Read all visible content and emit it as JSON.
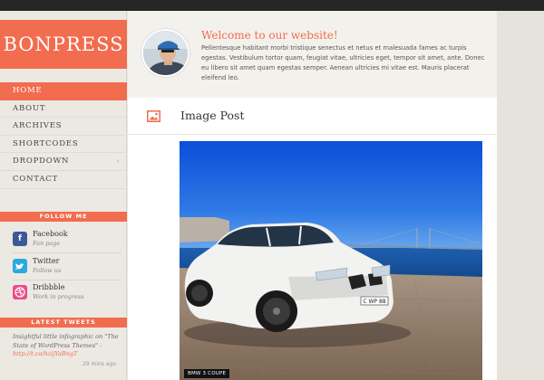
{
  "site": {
    "logo": "BONPRESS"
  },
  "nav": {
    "items": [
      {
        "label": "HOME",
        "active": true
      },
      {
        "label": "ABOUT"
      },
      {
        "label": "ARCHIVES"
      },
      {
        "label": "SHORTCODES"
      },
      {
        "label": "DROPDOWN",
        "has_submenu": true
      },
      {
        "label": "CONTACT"
      }
    ],
    "submenu_arrow": "›"
  },
  "follow": {
    "title": "FOLLOW ME",
    "items": [
      {
        "name": "Facebook",
        "sub": "Fan page",
        "icon": "facebook-icon",
        "color": "#3b5998"
      },
      {
        "name": "Twitter",
        "sub": "Follow us",
        "icon": "twitter-icon",
        "color": "#2aa9e0"
      },
      {
        "name": "Dribbble",
        "sub": "Work in progress",
        "icon": "dribbble-icon",
        "color": "#ea4c89"
      }
    ]
  },
  "tweets": {
    "title": "LATEST TWEETS",
    "text": "Insightful little infographic on \"The State of WordPress Themes\" -",
    "link": "http://t.co/hzijYaBngT",
    "time": "29 mins ago"
  },
  "welcome": {
    "title": "Welcome to our website!",
    "text": "Pellentesque habitant morbi tristique senectus et netus et malesuada fames ac turpis egestas. Vestibulum tortor quam, feugiat vitae, ultricies eget, tempor sit amet, ante. Donec eu libero sit amet quam egestas semper. Aenean ultricies mi vitae est. Mauris placerat eleifend leo."
  },
  "post": {
    "title": "Image Post",
    "icon": "image-icon",
    "image_caption": "BMW 3 COUPE"
  },
  "colors": {
    "accent": "#f26c4f",
    "topbar": "#262626",
    "sidebar": "#ece9e3"
  }
}
